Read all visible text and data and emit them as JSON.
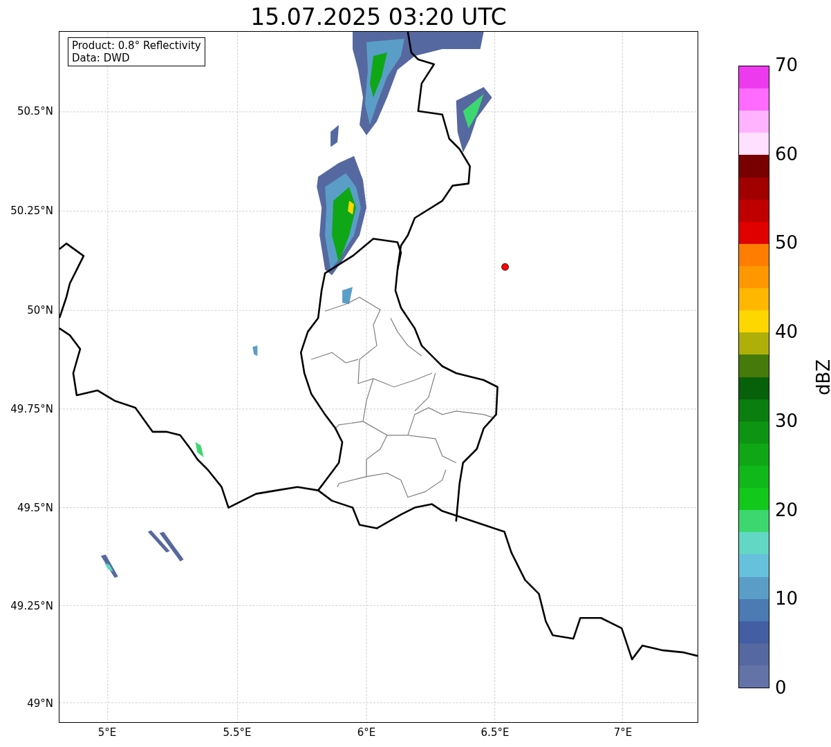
{
  "title": "15.07.2025 03:20 UTC",
  "info_box": [
    "Product: 0.8° Reflectivity",
    "Data: DWD"
  ],
  "yticks": [
    {
      "label": "50.5°N"
    },
    {
      "label": "50.25°N"
    },
    {
      "label": "50°N"
    },
    {
      "label": "49.75°N"
    },
    {
      "label": "49.5°N"
    },
    {
      "label": "49.25°N"
    },
    {
      "label": "49°N"
    }
  ],
  "xticks": [
    {
      "label": "5°E"
    },
    {
      "label": "5.5°E"
    },
    {
      "label": "6°E"
    },
    {
      "label": "6.5°E"
    },
    {
      "label": "7°E"
    }
  ],
  "colorbar": {
    "label": "dBZ",
    "ticks": [
      "70",
      "60",
      "50",
      "40",
      "30",
      "20",
      "10",
      "0"
    ],
    "bands": [
      {
        "color": "#6473a7"
      },
      {
        "color": "#5668a0"
      },
      {
        "color": "#435ea3"
      },
      {
        "color": "#4b7bb2"
      },
      {
        "color": "#5a9ec8"
      },
      {
        "color": "#66c1dc"
      },
      {
        "color": "#62d7c3"
      },
      {
        "color": "#3dd770"
      },
      {
        "color": "#12c81b"
      },
      {
        "color": "#10b81a"
      },
      {
        "color": "#0fa716"
      },
      {
        "color": "#0d9412"
      },
      {
        "color": "#0b7e10"
      },
      {
        "color": "#07600a"
      },
      {
        "color": "#467a0a"
      },
      {
        "color": "#aeb009"
      },
      {
        "color": "#ffd700"
      },
      {
        "color": "#ffb700"
      },
      {
        "color": "#ff9800"
      },
      {
        "color": "#ff7d00"
      },
      {
        "color": "#e00000"
      },
      {
        "color": "#c00000"
      },
      {
        "color": "#a00000"
      },
      {
        "color": "#780000"
      },
      {
        "color": "#ffe0ff"
      },
      {
        "color": "#ffb3ff"
      },
      {
        "color": "#ff6bff"
      },
      {
        "color": "#ee3aee"
      }
    ]
  }
}
